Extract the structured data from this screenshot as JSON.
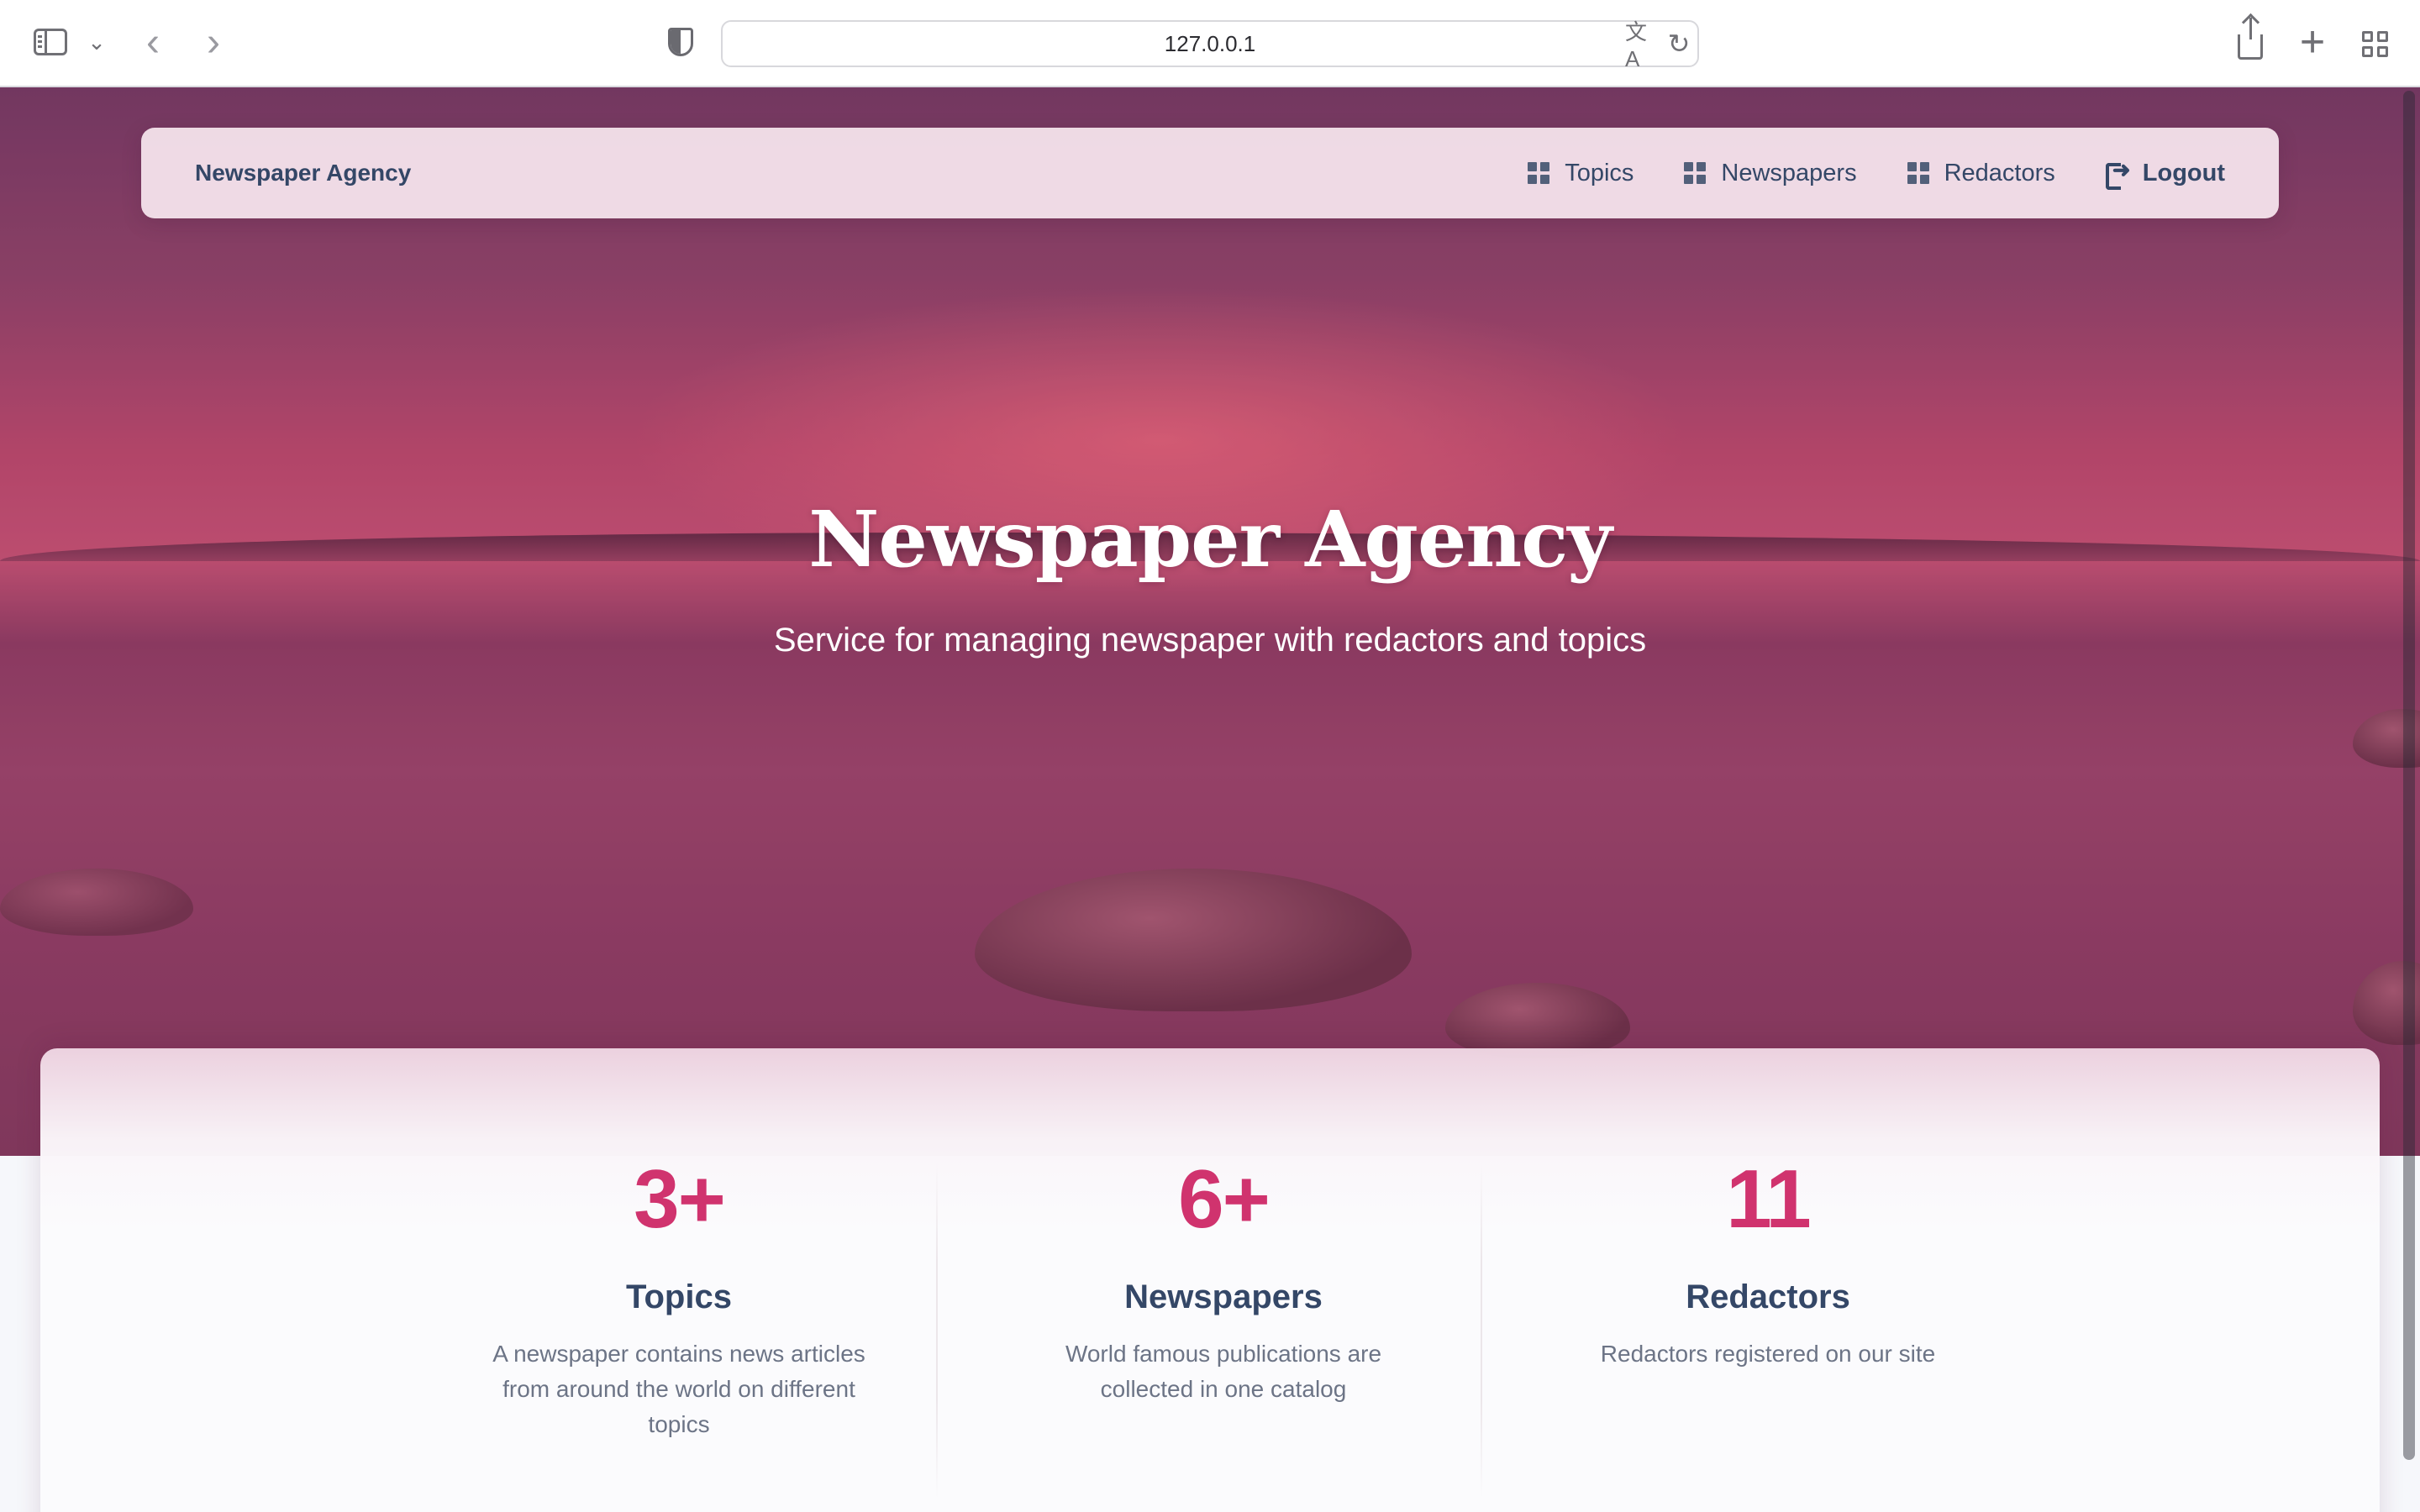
{
  "browser": {
    "url": "127.0.0.1",
    "icons": {
      "sidebar": "sidebar-icon",
      "back": "chevron-left-icon",
      "forward": "chevron-right-icon",
      "privacy": "shield-icon",
      "translate": "translate-icon",
      "reload": "reload-icon",
      "share": "share-icon",
      "new_tab": "plus-icon",
      "tab_overview": "grid-icon"
    }
  },
  "navbar": {
    "brand": "Newspaper Agency",
    "items": [
      {
        "label": "Topics",
        "icon": "dashboard-icon"
      },
      {
        "label": "Newspapers",
        "icon": "dashboard-icon"
      },
      {
        "label": "Redactors",
        "icon": "dashboard-icon"
      },
      {
        "label": "Logout",
        "icon": "logout-icon"
      }
    ]
  },
  "hero": {
    "title": "Newspaper Agency",
    "subtitle": "Service for managing newspaper with redactors and topics"
  },
  "stats": [
    {
      "value": "3+",
      "label": "Topics",
      "description": "A newspaper contains news articles from around the world on different topics"
    },
    {
      "value": "6+",
      "label": "Newspapers",
      "description": "World famous publications are collected in one catalog"
    },
    {
      "value": "11",
      "label": "Redactors",
      "description": "Redactors registered on our site"
    }
  ],
  "colors": {
    "accent": "#d0336e",
    "text_dark": "#344767",
    "text_muted": "#6c7486"
  }
}
